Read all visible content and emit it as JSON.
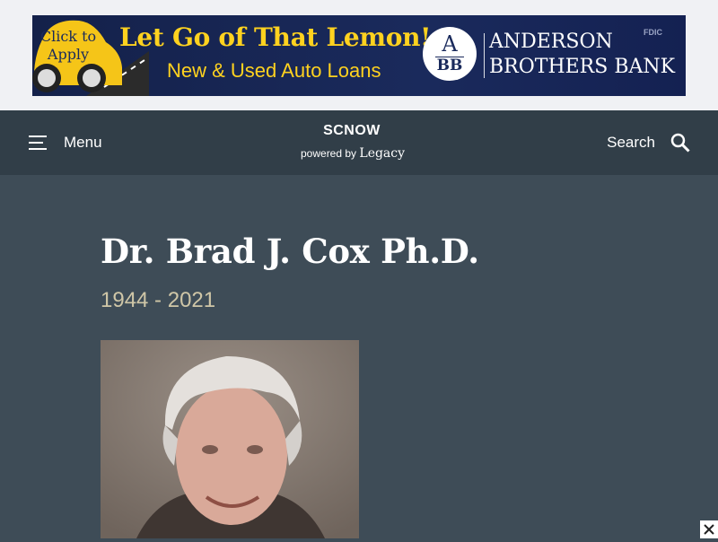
{
  "ad": {
    "click_label": "Click to Apply",
    "headline": "Let Go of That Lemon!",
    "subheadline": "New & Used Auto Loans",
    "logo_letters_top": "A",
    "logo_letters_bottom": "BB",
    "bank_line1": "ANDERSON",
    "bank_line2": "BROTHERS BANK",
    "fdic": "FDIC",
    "colors": {
      "background": "#1a2a5c",
      "headline": "#ffd21f",
      "car": "#f5c518"
    }
  },
  "header": {
    "menu_label": "Menu",
    "menu_icon": "hamburger-icon",
    "brand_name": "SCNOW",
    "powered_by": "powered by",
    "partner": "Legacy",
    "search_label": "Search",
    "search_icon": "magnifier-icon"
  },
  "obituary": {
    "name": "Dr. Brad J. Cox Ph.D.",
    "years": "1944 - 2021",
    "photo": "portrait-photo"
  },
  "overlay": {
    "close_icon": "close-icon"
  },
  "colors": {
    "page": "#3e4c57",
    "navbar": "#313e48",
    "years_text": "#cfc6a7"
  }
}
